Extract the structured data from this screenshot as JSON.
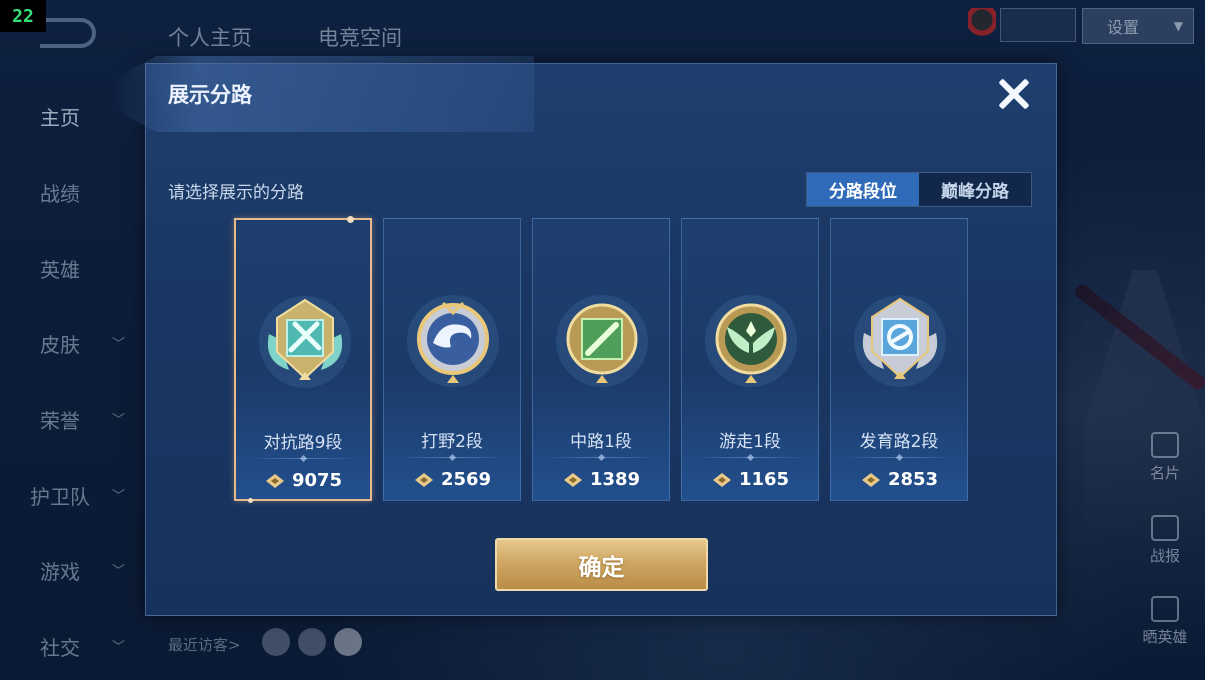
{
  "frame_counter": "22",
  "top_tabs": [
    {
      "label": "个人主页"
    },
    {
      "label": "电竞空间"
    }
  ],
  "left_nav": [
    {
      "label": "主页"
    },
    {
      "label": "战绩"
    },
    {
      "label": "英雄"
    },
    {
      "label": "皮肤"
    },
    {
      "label": "荣誉"
    },
    {
      "label": "护卫队"
    },
    {
      "label": "游戏"
    },
    {
      "label": "社交"
    }
  ],
  "top_right": {
    "settings_label": "设置"
  },
  "bottom": {
    "recent_visitors_label": "最近访客>"
  },
  "right_side": [
    {
      "label": "名片"
    },
    {
      "label": "战报"
    },
    {
      "label": "晒英雄"
    }
  ],
  "modal": {
    "title": "展示分路",
    "prompt": "请选择展示的分路",
    "toggle_tabs": [
      {
        "label": "分路段位",
        "active": true
      },
      {
        "label": "巅峰分路",
        "active": false
      }
    ],
    "cards": [
      {
        "lane": "对抗路9段",
        "score": "9075",
        "selected": true,
        "badge": "sword-badge-icon"
      },
      {
        "lane": "打野2段",
        "score": "2569",
        "selected": false,
        "badge": "dragon-badge-icon"
      },
      {
        "lane": "中路1段",
        "score": "1389",
        "selected": false,
        "badge": "staff-badge-icon"
      },
      {
        "lane": "游走1段",
        "score": "1165",
        "selected": false,
        "badge": "wings-badge-icon"
      },
      {
        "lane": "发育路2段",
        "score": "2853",
        "selected": false,
        "badge": "target-badge-icon"
      }
    ],
    "confirm_label": "确定"
  },
  "colors": {
    "modal_bg": "#1b3a68",
    "selected_border": "#e8b98a",
    "active_tab": "#2f6bb8",
    "confirm_gold": "#cfa763"
  }
}
